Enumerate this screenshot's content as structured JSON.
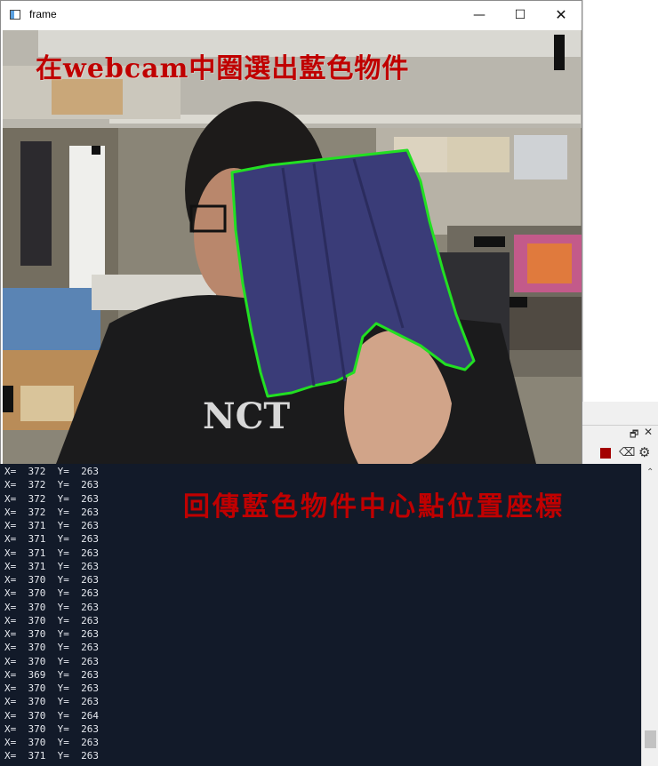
{
  "window": {
    "title": "frame",
    "minimize_glyph": "—",
    "maximize_glyph": "☐",
    "close_glyph": "✕"
  },
  "webcam": {
    "caption": "在webcam中圈選出藍色物件",
    "contour_color": "#22e022",
    "object_color": "#3a3c78"
  },
  "console": {
    "caption": "回傳藍色物件中心點位置座標",
    "lines": [
      "X=  372  Y=  263",
      "X=  372  Y=  263",
      "X=  372  Y=  263",
      "X=  372  Y=  263",
      "X=  371  Y=  263",
      "X=  371  Y=  263",
      "X=  371  Y=  263",
      "X=  371  Y=  263",
      "X=  370  Y=  263",
      "X=  370  Y=  263",
      "X=  370  Y=  263",
      "X=  370  Y=  263",
      "X=  370  Y=  263",
      "X=  370  Y=  263",
      "X=  370  Y=  263",
      "X=  369  Y=  263",
      "X=  370  Y=  263",
      "X=  370  Y=  263",
      "X=  370  Y=  264",
      "X=  370  Y=  263",
      "X=  370  Y=  263",
      "X=  371  Y=  263"
    ],
    "scroll_up_glyph": "⌃"
  },
  "ide_toolbar": {
    "restore_glyph": "🗗",
    "close_glyph": "✕",
    "eraser_glyph": "⌫",
    "gear_glyph": "⚙",
    "stop_color": "#a30000"
  }
}
